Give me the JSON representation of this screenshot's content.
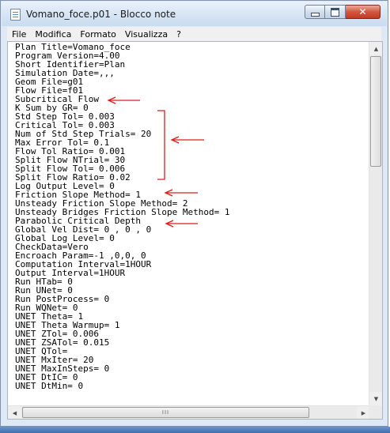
{
  "window": {
    "title": "Vomano_foce.p01 - Blocco note",
    "app_icon": "notepad-icon",
    "controls": {
      "minimize_icon": "minimize-icon",
      "maximize_icon": "maximize-icon",
      "close_icon": "close-icon",
      "close_glyph": "✕"
    }
  },
  "menu": [
    "File",
    "Modifica",
    "Formato",
    "Visualizza",
    "?"
  ],
  "lines": [
    "Plan Title=Vomano_foce",
    "Program Version=4.00",
    "Short Identifier=Plan",
    "Simulation Date=,,,",
    "Geom File=g01",
    "Flow File=f01",
    "Subcritical Flow",
    "K Sum by GR= 0",
    "Std Step Tol= 0.003",
    "Critical Tol= 0.003",
    "Num of Std Step Trials= 20",
    "Max Error Tol= 0.1",
    "Flow Tol Ratio= 0.001",
    "Split Flow NTrial= 30",
    "Split Flow Tol= 0.006",
    "Split Flow Ratio= 0.02",
    "Log Output Level= 0",
    "Friction Slope Method= 1",
    "Unsteady Friction Slope Method= 2",
    "Unsteady Bridges Friction Slope Method= 1",
    "Parabolic Critical Depth",
    "Global Vel Dist= 0 , 0 , 0",
    "Global Log Level= 0",
    "CheckData=Vero",
    "Encroach Param=-1 ,0,0, 0",
    "Computation Interval=1HOUR",
    "Output Interval=1HOUR",
    "Run HTab= 0",
    "Run UNet= 0",
    "Run PostProcess= 0",
    "Run WQNet= 0",
    "UNET Theta= 1",
    "UNET Theta Warmup= 1",
    "UNET ZTol= 0.006",
    "UNET ZSATol= 0.015",
    "UNET QTol=",
    "UNET MxIter= 20",
    "UNET MaxInSteps= 0",
    "UNET DtIC= 0",
    "UNET DtMin= 0"
  ],
  "scrollbars": {
    "up_arrow": "▲",
    "down_arrow": "▼",
    "left_arrow": "◀",
    "right_arrow": "▶",
    "grip": "III"
  },
  "annotations": {
    "color": "#dd1c1c"
  },
  "colors": {
    "titlebar": "#d6e4f4",
    "close_button": "#c94a32",
    "taskbar": "#4a78b8"
  }
}
